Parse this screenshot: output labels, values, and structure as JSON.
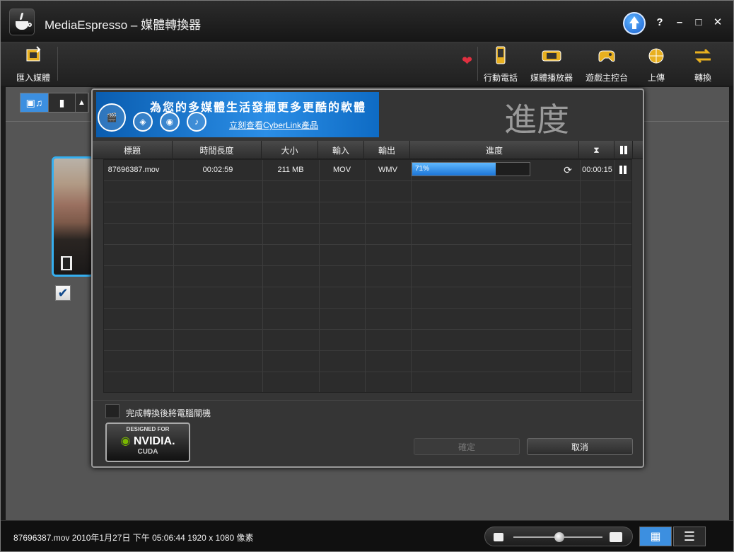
{
  "window": {
    "title": "MediaEspresso – 媒體轉換器"
  },
  "title_controls": {
    "help": "?",
    "minimize": "–",
    "maximize": "□",
    "close": "✕"
  },
  "toolbar": {
    "import_label": "匯入媒體",
    "items": [
      {
        "label": "行動電話",
        "icon": "mobile-phone-icon"
      },
      {
        "label": "媒體播放器",
        "icon": "media-player-icon"
      },
      {
        "label": "遊戲主控台",
        "icon": "game-console-icon"
      },
      {
        "label": "上傳",
        "icon": "upload-globe-icon"
      },
      {
        "label": "轉換",
        "icon": "convert-arrows-icon"
      }
    ]
  },
  "dialog": {
    "banner_title": "為您的多媒體生活發掘更多更酷的軟體",
    "banner_link": "立刻查看CyberLink產品",
    "title": "進度",
    "columns": [
      "標題",
      "時間長度",
      "大小",
      "輸入",
      "輸出",
      "進度"
    ],
    "rows": [
      {
        "title": "87696387.mov",
        "duration": "00:02:59",
        "size": "211 MB",
        "input": "MOV",
        "output": "WMV",
        "progress_text": "71%",
        "progress": 0.71,
        "remaining": "00:00:15"
      }
    ],
    "shutdown_label": "完成轉換後將電腦關機",
    "nvidia": {
      "line1": "DESIGNED FOR",
      "line2": "NVIDIA.",
      "line3": "CUDA"
    },
    "ok_label": "確定",
    "cancel_label": "取消"
  },
  "statusbar": {
    "text": "87696387.mov 2010年1月27日 下午 05:06:44 1920 x 1080 像素"
  },
  "colors": {
    "accent": "#3c8fe0",
    "progress": "#2a8cf0",
    "heart": "#e03040"
  }
}
